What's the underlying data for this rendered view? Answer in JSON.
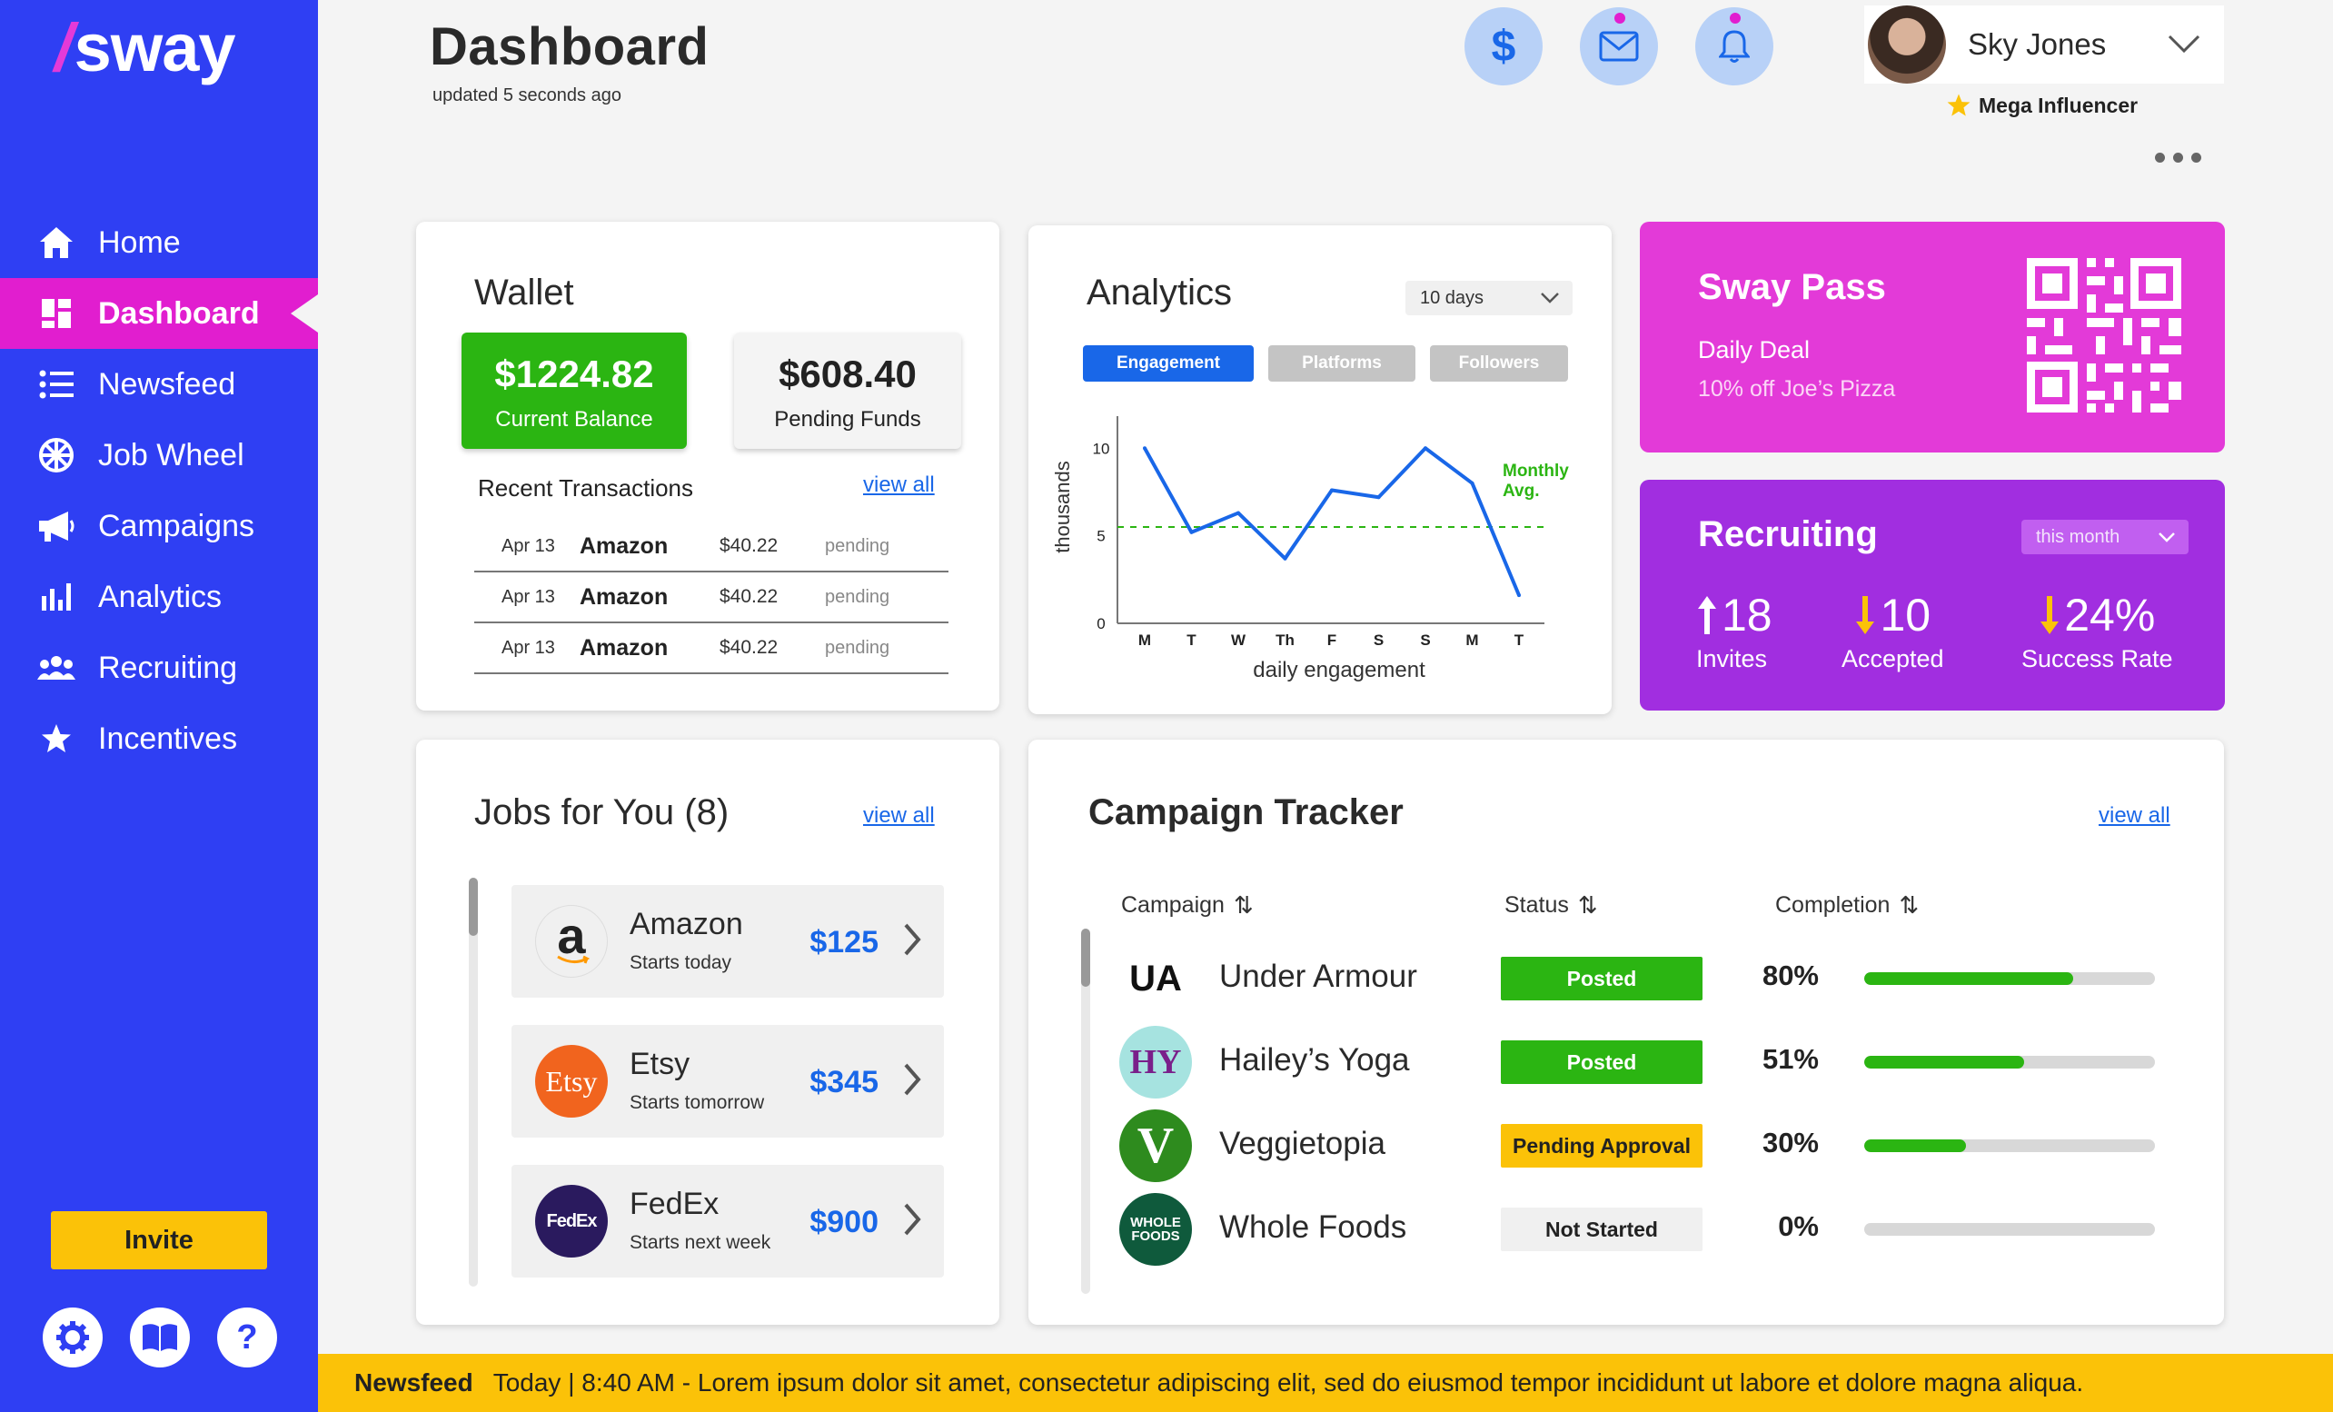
{
  "app": {
    "logo_slash": "/",
    "logo_text": "sway"
  },
  "sidebar": {
    "items": [
      {
        "label": "Home",
        "icon": "home-icon"
      },
      {
        "label": "Dashboard",
        "icon": "dashboard-icon",
        "active": true
      },
      {
        "label": "Newsfeed",
        "icon": "list-icon"
      },
      {
        "label": "Job Wheel",
        "icon": "wheel-icon"
      },
      {
        "label": "Campaigns",
        "icon": "megaphone-icon"
      },
      {
        "label": "Analytics",
        "icon": "bar-chart-icon"
      },
      {
        "label": "Recruiting",
        "icon": "people-icon"
      },
      {
        "label": "Incentives",
        "icon": "star-icon"
      }
    ],
    "invite_label": "Invite",
    "bottom_icons": [
      "gear-icon",
      "book-icon",
      "help-icon"
    ],
    "help_glyph": "?"
  },
  "header": {
    "title": "Dashboard",
    "subtitle": "updated 5 seconds ago",
    "user_name": "Sky Jones",
    "user_badge": "Mega Influencer",
    "header_icons": [
      "dollar-icon",
      "mail-icon",
      "bell-icon"
    ],
    "dollar_glyph": "$"
  },
  "wallet": {
    "title": "Wallet",
    "balance_amount": "$1224.82",
    "balance_label": "Current Balance",
    "pending_amount": "$608.40",
    "pending_label": "Pending Funds",
    "transactions_title": "Recent Transactions",
    "view_all": "view all",
    "transactions": [
      {
        "date": "Apr 13",
        "merchant": "Amazon",
        "amount": "$40.22",
        "status": "pending"
      },
      {
        "date": "Apr 13",
        "merchant": "Amazon",
        "amount": "$40.22",
        "status": "pending"
      },
      {
        "date": "Apr 13",
        "merchant": "Amazon",
        "amount": "$40.22",
        "status": "pending"
      }
    ]
  },
  "analytics": {
    "title": "Analytics",
    "range": "10 days",
    "tabs": [
      {
        "label": "Engagement",
        "active": true
      },
      {
        "label": "Platforms",
        "active": false
      },
      {
        "label": "Followers",
        "active": false
      }
    ],
    "monthly_avg_label_1": "Monthly",
    "monthly_avg_label_2": "Avg."
  },
  "chart_data": {
    "type": "line",
    "categories": [
      "M",
      "T",
      "W",
      "Th",
      "F",
      "S",
      "S",
      "M",
      "T"
    ],
    "values": [
      10,
      5.2,
      6.3,
      3.7,
      7.6,
      7.2,
      10,
      8,
      1.6
    ],
    "average": 5.5,
    "xlabel": "daily engagement",
    "ylabel": "thousands",
    "yticks": [
      "0",
      "5",
      "10"
    ],
    "ylim": [
      0,
      11
    ],
    "line_color": "#1967e8",
    "avg_color": "#2bb512"
  },
  "sway_pass": {
    "title": "Sway Pass",
    "deal_title": "Daily Deal",
    "deal_text": "10% off Joe’s Pizza"
  },
  "recruiting": {
    "title": "Recruiting",
    "period": "this month",
    "stats": [
      {
        "value": "18",
        "label": "Invites",
        "arrow": "up",
        "arrow_color": "#ffffff"
      },
      {
        "value": "10",
        "label": "Accepted",
        "arrow": "down",
        "arrow_color": "#fbc208"
      },
      {
        "value": "24%",
        "label": "Success Rate",
        "arrow": "down",
        "arrow_color": "#fbc208"
      }
    ]
  },
  "jobs": {
    "title": "Jobs for You",
    "count": "(8)",
    "view_all": "view all",
    "items": [
      {
        "company": "Amazon",
        "start": "Starts today",
        "pay": "$125",
        "logo_text": "a",
        "logo_bg": "#ffffff",
        "logo_color": "#111111"
      },
      {
        "company": "Etsy",
        "start": "Starts tomorrow",
        "pay": "$345",
        "logo_text": "Etsy",
        "logo_bg": "#f1641e",
        "logo_color": "#ffffff"
      },
      {
        "company": "FedEx",
        "start": "Starts next week",
        "pay": "$900",
        "logo_text": "FedEx",
        "logo_bg": "#2a1a5e",
        "logo_color": "#ffffff"
      }
    ]
  },
  "campaigns": {
    "title": "Campaign Tracker",
    "view_all": "view all",
    "columns": [
      "Campaign",
      "Status",
      "Completion"
    ],
    "rows": [
      {
        "name": "Under Armour",
        "status": "Posted",
        "status_bg": "#2bb512",
        "status_color": "#ffffff",
        "completion": "80%",
        "progress": 0.72,
        "logo_text": "UA",
        "logo_bg": "#ffffff",
        "logo_color": "#111111"
      },
      {
        "name": "Hailey’s Yoga",
        "status": "Posted",
        "status_bg": "#2bb512",
        "status_color": "#ffffff",
        "completion": "51%",
        "progress": 0.55,
        "logo_text": "HY",
        "logo_bg": "#a6e3e0",
        "logo_color": "#7a1f8a"
      },
      {
        "name": "Veggietopia",
        "status": "Pending Approval",
        "status_bg": "#fbc208",
        "status_color": "#222222",
        "completion": "30%",
        "progress": 0.35,
        "logo_text": "V",
        "logo_bg": "#2e8b1e",
        "logo_color": "#ffffff"
      },
      {
        "name": "Whole Foods",
        "status": "Not Started",
        "status_bg": "#f0f0f0",
        "status_color": "#222222",
        "completion": "0%",
        "progress": 0,
        "logo_text": "WHOLE FOODS",
        "logo_bg": "#0f5a3c",
        "logo_color": "#ffffff"
      }
    ]
  },
  "ticker": {
    "label": "Newsfeed",
    "text": "Today | 8:40 AM - Lorem ipsum dolor sit amet, consectetur adipiscing elit, sed do eiusmod tempor incididunt ut labore et dolore magna aliqua."
  },
  "colors": {
    "sidebar": "#2f3ff3",
    "active": "#e11ecf",
    "accent_blue": "#1967e8",
    "green": "#2bb512",
    "yellow": "#fbc208",
    "pass_pink": "#e33ad8",
    "recruit_purple": "#a12ee0"
  }
}
